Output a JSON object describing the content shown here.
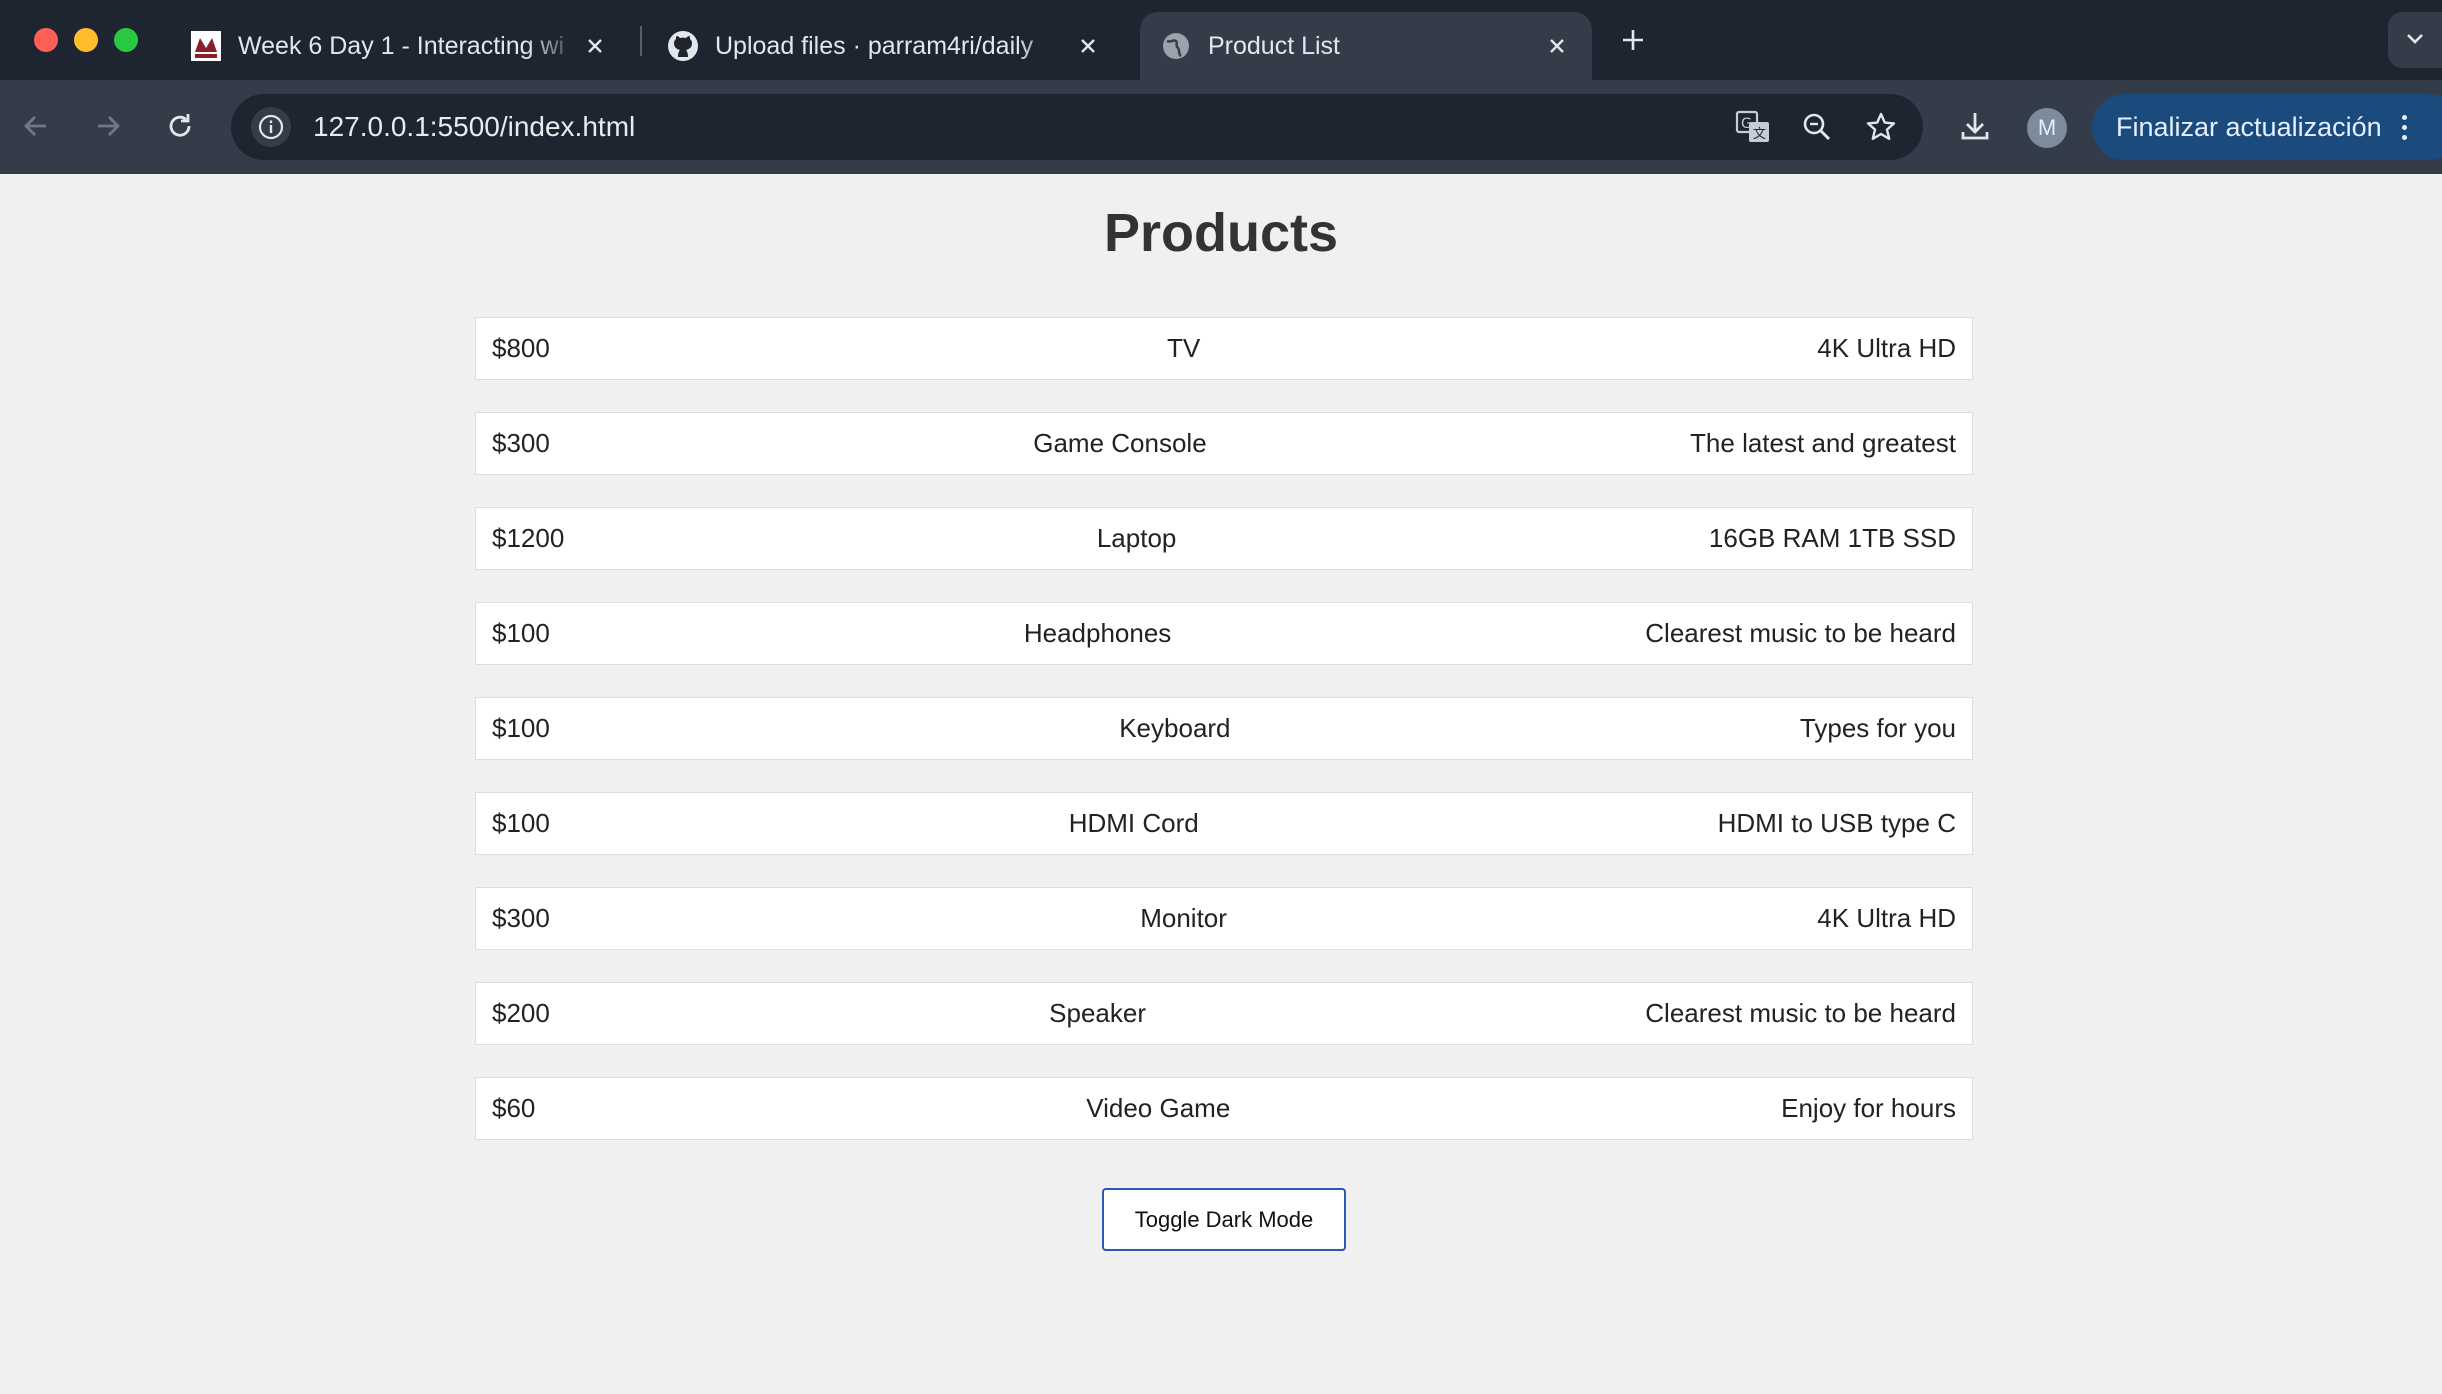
{
  "browser": {
    "tabs": [
      {
        "title": "Week 6 Day 1 - Interacting wi",
        "icon": "school-logo-icon",
        "active": false
      },
      {
        "title": "Upload files · parram4ri/daily",
        "icon": "github-icon",
        "active": false
      },
      {
        "title": "Product List",
        "icon": "globe-icon",
        "active": true
      }
    ],
    "address": {
      "url": "127.0.0.1:5500/index.html"
    },
    "profile_initial": "M",
    "update_label": "Finalizar actualización"
  },
  "page": {
    "title": "Products",
    "products": [
      {
        "price": "$800",
        "name": "TV",
        "description": "4K Ultra HD"
      },
      {
        "price": "$300",
        "name": "Game Console",
        "description": "The latest and greatest"
      },
      {
        "price": "$1200",
        "name": "Laptop",
        "description": "16GB RAM 1TB SSD"
      },
      {
        "price": "$100",
        "name": "Headphones",
        "description": "Clearest music to be heard"
      },
      {
        "price": "$100",
        "name": "Keyboard",
        "description": "Types for you"
      },
      {
        "price": "$100",
        "name": "HDMI Cord",
        "description": "HDMI to USB type C"
      },
      {
        "price": "$300",
        "name": "Monitor",
        "description": "4K Ultra HD"
      },
      {
        "price": "$200",
        "name": "Speaker",
        "description": "Clearest music to be heard"
      },
      {
        "price": "$60",
        "name": "Video Game",
        "description": "Enjoy for hours"
      }
    ],
    "toggle_label": "Toggle Dark Mode"
  }
}
